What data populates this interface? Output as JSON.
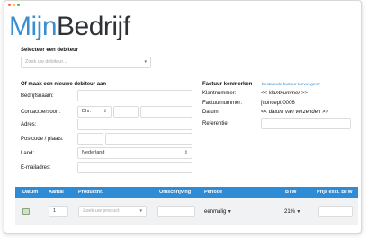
{
  "logo": {
    "part1": "Mijn",
    "part2": "Bedrijf"
  },
  "debiteur": {
    "heading": "Selecteer een debiteur",
    "search_placeholder": "Zoek uw debiteur..."
  },
  "new_debiteur": {
    "heading": "Of maak een nieuwe debiteur aan",
    "bedrijfsnaam_label": "Bedrijfsnaam:",
    "contactpersoon_label": "Contactpersoon:",
    "salutation_value": "Dhr.",
    "adres_label": "Adres:",
    "postcode_label": "Postcode / plaats:",
    "land_label": "Land:",
    "land_value": "Nederland",
    "email_label": "E-mailadres:"
  },
  "factuur": {
    "heading": "Factuur kenmerken",
    "link": "bestaande factuur toevoegen?",
    "klantnummer_label": "Klantnummer:",
    "klantnummer_value": "<< klantnummer >>",
    "factuurnummer_label": "Factuurnummer:",
    "factuurnummer_value": "[concept]0006",
    "datum_label": "Datum:",
    "datum_value": "<< datum van verzenden >>",
    "referentie_label": "Referentie:"
  },
  "table": {
    "headers": [
      "Datum",
      "Aantal",
      "Productnr.",
      "Omschrijving",
      "Periode",
      "BTW",
      "Prijs excl. BTW"
    ],
    "row": {
      "aantal": "1",
      "product_placeholder": "Zoek uw product",
      "periode": "eenmalig",
      "btw": "21%"
    }
  },
  "colors": {
    "accent": "#2e8bd6",
    "logo_blue": "#3b8ed0",
    "traffic_lights": [
      "#ff5f57",
      "#ffbd2e",
      "#28c940"
    ]
  }
}
